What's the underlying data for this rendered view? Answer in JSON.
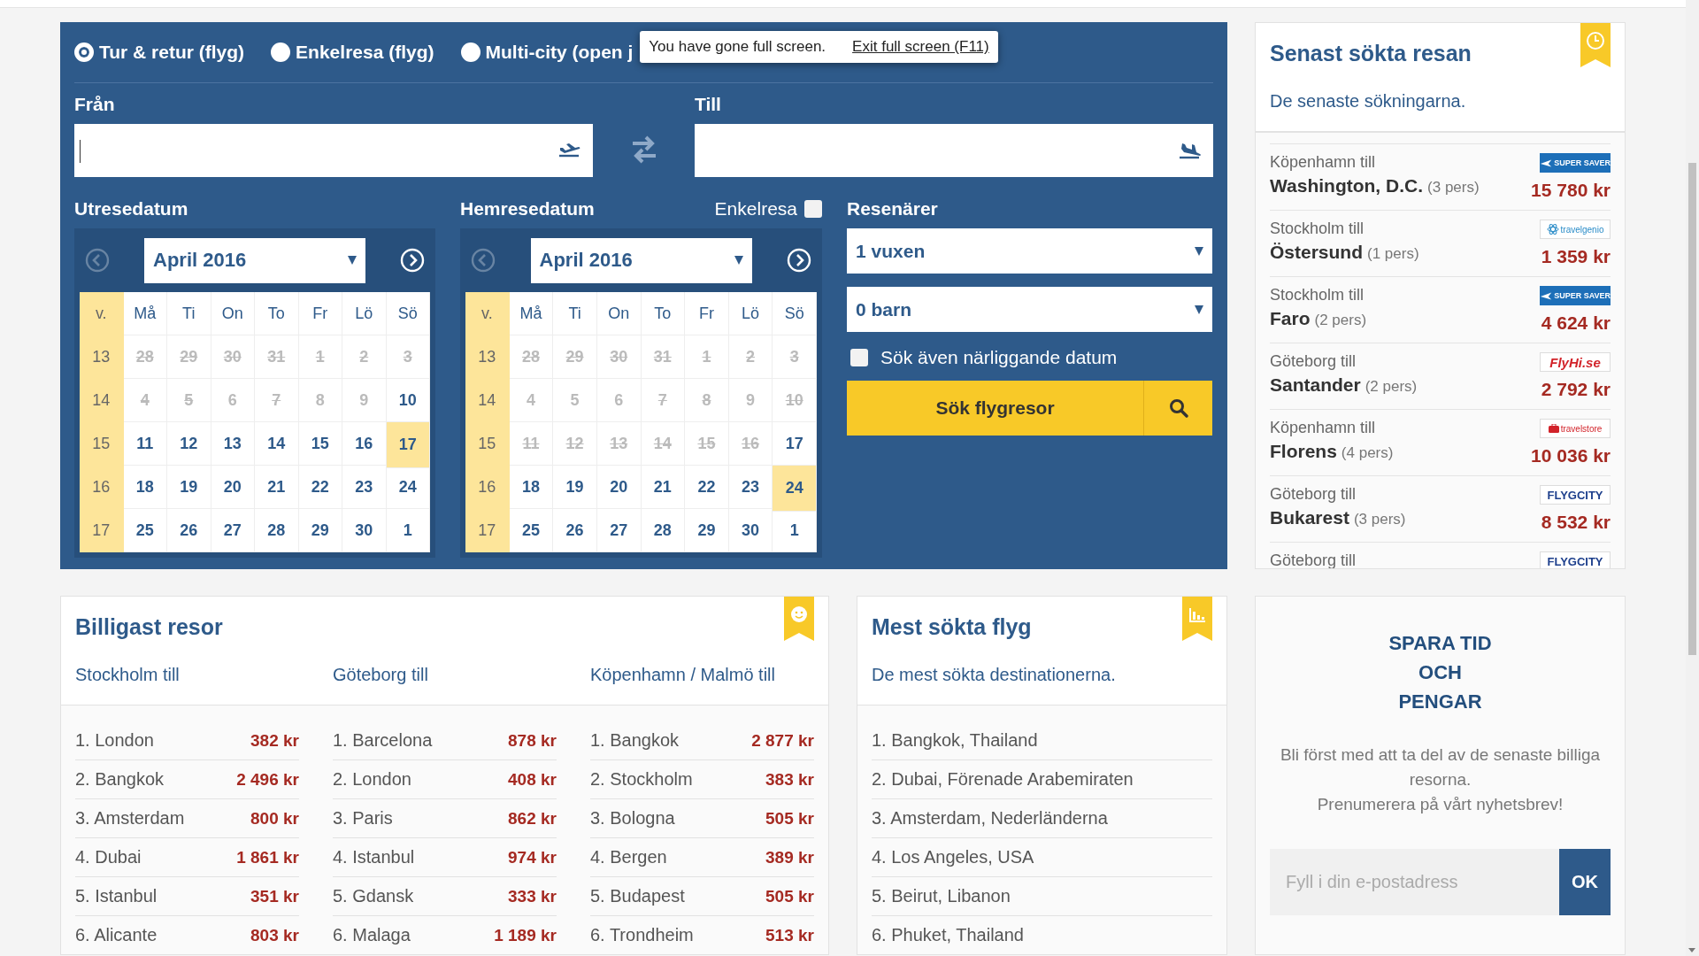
{
  "browser_toast": {
    "message": "You have gone full screen.",
    "link": "Exit full screen (F11)"
  },
  "search": {
    "trip_types": [
      {
        "label": "Tur & retur (flyg)",
        "selected": true
      },
      {
        "label": "Enkelresa (flyg)",
        "selected": false
      },
      {
        "label": "Multi-city (open j",
        "selected": false
      }
    ],
    "from": {
      "label": "Från",
      "focused": true
    },
    "to": {
      "label": "Till",
      "focused": false
    },
    "calendars": [
      {
        "label": "Utresedatum",
        "month": "April 2016",
        "prev_disabled": true,
        "week_heading": "v.",
        "weekdays": [
          "Må",
          "Ti",
          "On",
          "To",
          "Fr",
          "Lö",
          "Sö"
        ],
        "weeks": [
          {
            "week": "13",
            "days": [
              {
                "day": "28",
                "available": false,
                "struck": true,
                "selected": false
              },
              {
                "day": "29",
                "available": false,
                "struck": true,
                "selected": false
              },
              {
                "day": "30",
                "available": false,
                "struck": true,
                "selected": false
              },
              {
                "day": "31",
                "available": false,
                "struck": true,
                "selected": false
              },
              {
                "day": "1",
                "available": false,
                "struck": true,
                "selected": false
              },
              {
                "day": "2",
                "available": false,
                "struck": true,
                "selected": false
              },
              {
                "day": "3",
                "available": false,
                "struck": true,
                "selected": false
              }
            ]
          },
          {
            "week": "14",
            "days": [
              {
                "day": "4",
                "available": false,
                "struck": true,
                "selected": false
              },
              {
                "day": "5",
                "available": false,
                "struck": true,
                "selected": false
              },
              {
                "day": "6",
                "available": false,
                "struck": false,
                "selected": false
              },
              {
                "day": "7",
                "available": false,
                "struck": true,
                "selected": false
              },
              {
                "day": "8",
                "available": false,
                "struck": false,
                "selected": false
              },
              {
                "day": "9",
                "available": false,
                "struck": false,
                "selected": false
              },
              {
                "day": "10",
                "available": true,
                "struck": false,
                "selected": false
              }
            ]
          },
          {
            "week": "15",
            "days": [
              {
                "day": "11",
                "available": true,
                "struck": false,
                "selected": false
              },
              {
                "day": "12",
                "available": true,
                "struck": false,
                "selected": false
              },
              {
                "day": "13",
                "available": true,
                "struck": false,
                "selected": false
              },
              {
                "day": "14",
                "available": true,
                "struck": false,
                "selected": false
              },
              {
                "day": "15",
                "available": true,
                "struck": false,
                "selected": false
              },
              {
                "day": "16",
                "available": true,
                "struck": false,
                "selected": false
              },
              {
                "day": "17",
                "available": true,
                "struck": false,
                "selected": true
              }
            ]
          },
          {
            "week": "16",
            "days": [
              {
                "day": "18",
                "available": true,
                "struck": false,
                "selected": false
              },
              {
                "day": "19",
                "available": true,
                "struck": false,
                "selected": false
              },
              {
                "day": "20",
                "available": true,
                "struck": false,
                "selected": false
              },
              {
                "day": "21",
                "available": true,
                "struck": false,
                "selected": false
              },
              {
                "day": "22",
                "available": true,
                "struck": false,
                "selected": false
              },
              {
                "day": "23",
                "available": true,
                "struck": false,
                "selected": false
              },
              {
                "day": "24",
                "available": true,
                "struck": false,
                "selected": false
              }
            ]
          },
          {
            "week": "17",
            "days": [
              {
                "day": "25",
                "available": true,
                "struck": false,
                "selected": false
              },
              {
                "day": "26",
                "available": true,
                "struck": false,
                "selected": false
              },
              {
                "day": "27",
                "available": true,
                "struck": false,
                "selected": false
              },
              {
                "day": "28",
                "available": true,
                "struck": false,
                "selected": false
              },
              {
                "day": "29",
                "available": true,
                "struck": false,
                "selected": false
              },
              {
                "day": "30",
                "available": true,
                "struck": false,
                "selected": false
              },
              {
                "day": "1",
                "available": true,
                "struck": false,
                "selected": false
              }
            ]
          }
        ]
      },
      {
        "label": "Hemresedatum",
        "month": "April 2016",
        "prev_disabled": true,
        "week_heading": "v.",
        "weekdays": [
          "Må",
          "Ti",
          "On",
          "To",
          "Fr",
          "Lö",
          "Sö"
        ],
        "weeks": [
          {
            "week": "13",
            "days": [
              {
                "day": "28",
                "available": false,
                "struck": true,
                "selected": false
              },
              {
                "day": "29",
                "available": false,
                "struck": true,
                "selected": false
              },
              {
                "day": "30",
                "available": false,
                "struck": true,
                "selected": false
              },
              {
                "day": "31",
                "available": false,
                "struck": true,
                "selected": false
              },
              {
                "day": "1",
                "available": false,
                "struck": true,
                "selected": false
              },
              {
                "day": "2",
                "available": false,
                "struck": true,
                "selected": false
              },
              {
                "day": "3",
                "available": false,
                "struck": true,
                "selected": false
              }
            ]
          },
          {
            "week": "14",
            "days": [
              {
                "day": "4",
                "available": false,
                "struck": false,
                "selected": false
              },
              {
                "day": "5",
                "available": false,
                "struck": false,
                "selected": false
              },
              {
                "day": "6",
                "available": false,
                "struck": false,
                "selected": false
              },
              {
                "day": "7",
                "available": false,
                "struck": true,
                "selected": false
              },
              {
                "day": "8",
                "available": false,
                "struck": true,
                "selected": false
              },
              {
                "day": "9",
                "available": false,
                "struck": false,
                "selected": false
              },
              {
                "day": "10",
                "available": false,
                "struck": true,
                "selected": false
              }
            ]
          },
          {
            "week": "15",
            "days": [
              {
                "day": "11",
                "available": false,
                "struck": true,
                "selected": false
              },
              {
                "day": "12",
                "available": false,
                "struck": true,
                "selected": false
              },
              {
                "day": "13",
                "available": false,
                "struck": true,
                "selected": false
              },
              {
                "day": "14",
                "available": false,
                "struck": true,
                "selected": false
              },
              {
                "day": "15",
                "available": false,
                "struck": true,
                "selected": false
              },
              {
                "day": "16",
                "available": false,
                "struck": true,
                "selected": false
              },
              {
                "day": "17",
                "available": true,
                "struck": false,
                "selected": false
              }
            ]
          },
          {
            "week": "16",
            "days": [
              {
                "day": "18",
                "available": true,
                "struck": false,
                "selected": false
              },
              {
                "day": "19",
                "available": true,
                "struck": false,
                "selected": false
              },
              {
                "day": "20",
                "available": true,
                "struck": false,
                "selected": false
              },
              {
                "day": "21",
                "available": true,
                "struck": false,
                "selected": false
              },
              {
                "day": "22",
                "available": true,
                "struck": false,
                "selected": false
              },
              {
                "day": "23",
                "available": true,
                "struck": false,
                "selected": false
              },
              {
                "day": "24",
                "available": true,
                "struck": false,
                "selected": true
              }
            ]
          },
          {
            "week": "17",
            "days": [
              {
                "day": "25",
                "available": true,
                "struck": false,
                "selected": false
              },
              {
                "day": "26",
                "available": true,
                "struck": false,
                "selected": false
              },
              {
                "day": "27",
                "available": true,
                "struck": false,
                "selected": false
              },
              {
                "day": "28",
                "available": true,
                "struck": false,
                "selected": false
              },
              {
                "day": "29",
                "available": true,
                "struck": false,
                "selected": false
              },
              {
                "day": "30",
                "available": true,
                "struck": false,
                "selected": false
              },
              {
                "day": "1",
                "available": true,
                "struck": false,
                "selected": false
              }
            ]
          }
        ]
      }
    ],
    "one_way": {
      "label": "Enkelresa",
      "checked": false
    },
    "travelers": {
      "label": "Resenärer",
      "adults": "1 vuxen",
      "children": "0 barn"
    },
    "nearby_dates": {
      "label": "Sök även närliggande datum",
      "checked": false
    },
    "submit": "Sök flygresor"
  },
  "recent": {
    "title": "Senast sökta resan",
    "subtitle": "De senaste sökningarna.",
    "items": [
      {
        "origin": "Köpenhamn till",
        "destination": "Washington, D.C.",
        "travelers": "(3 pers)",
        "price": "15 780 kr",
        "logo": {
          "kind": "supersaver",
          "text": "SUPER SAVER"
        }
      },
      {
        "origin": "Stockholm till",
        "destination": "Östersund",
        "travelers": "(1 pers)",
        "price": "1 359 kr",
        "logo": {
          "kind": "travelgenio",
          "text": "travelgenio"
        }
      },
      {
        "origin": "Stockholm till",
        "destination": "Faro",
        "travelers": "(2 pers)",
        "price": "4 624 kr",
        "logo": {
          "kind": "supersaver",
          "text": "SUPER SAVER"
        }
      },
      {
        "origin": "Göteborg till",
        "destination": "Santander",
        "travelers": "(2 pers)",
        "price": "2 792 kr",
        "logo": {
          "kind": "flyhi",
          "text": "FlyHi.se"
        }
      },
      {
        "origin": "Köpenhamn till",
        "destination": "Florens",
        "travelers": "(4 pers)",
        "price": "10 036 kr",
        "logo": {
          "kind": "travelstore",
          "text": "travelstore"
        }
      },
      {
        "origin": "Göteborg till",
        "destination": "Bukarest",
        "travelers": "(3 pers)",
        "price": "8 532 kr",
        "logo": {
          "kind": "flygcity",
          "text": "FLYGCITY"
        }
      },
      {
        "origin": "Göteborg till",
        "logo": {
          "kind": "flygcity",
          "text": "FLYGCITY"
        }
      }
    ]
  },
  "cheapest": {
    "title": "Billigast resor",
    "columns": [
      {
        "heading": "Stockholm till",
        "rows": [
          {
            "place": "1. London",
            "price": "382 kr"
          },
          {
            "place": "2. Bangkok",
            "price": "2 496 kr"
          },
          {
            "place": "3. Amsterdam",
            "price": "800 kr"
          },
          {
            "place": "4. Dubai",
            "price": "1 861 kr"
          },
          {
            "place": "5. Istanbul",
            "price": "351 kr"
          },
          {
            "place": "6. Alicante",
            "price": "803 kr"
          }
        ]
      },
      {
        "heading": "Göteborg till",
        "rows": [
          {
            "place": "1. Barcelona",
            "price": "878 kr"
          },
          {
            "place": "2. London",
            "price": "408 kr"
          },
          {
            "place": "3. Paris",
            "price": "862 kr"
          },
          {
            "place": "4. Istanbul",
            "price": "974 kr"
          },
          {
            "place": "5. Gdansk",
            "price": "333 kr"
          },
          {
            "place": "6. Malaga",
            "price": "1 189 kr"
          }
        ]
      },
      {
        "heading": "Köpenhamn / Malmö till",
        "rows": [
          {
            "place": "1. Bangkok",
            "price": "2 877 kr"
          },
          {
            "place": "2. Stockholm",
            "price": "383 kr"
          },
          {
            "place": "3. Bologna",
            "price": "505 kr"
          },
          {
            "place": "4. Bergen",
            "price": "389 kr"
          },
          {
            "place": "5. Budapest",
            "price": "505 kr"
          },
          {
            "place": "6. Trondheim",
            "price": "513 kr"
          }
        ]
      }
    ]
  },
  "most_searched": {
    "title": "Mest sökta flyg",
    "subtitle": "De mest sökta destinationerna.",
    "items": [
      "1. Bangkok, Thailand",
      "2. Dubai, Förenade Arabemiraten",
      "3. Amsterdam, Nederländerna",
      "4. Los Angeles, USA",
      "5. Beirut, Libanon",
      "6. Phuket, Thailand"
    ]
  },
  "newsletter": {
    "title_lines": [
      "SPARA TID",
      "OCH",
      "PENGAR"
    ],
    "text_lines": [
      "Bli först med att ta del av de senaste billiga resorna.",
      "Prenumerera på vårt nyhetsbrev!"
    ],
    "placeholder": "Fyll i din e-postadress",
    "button": "OK"
  }
}
